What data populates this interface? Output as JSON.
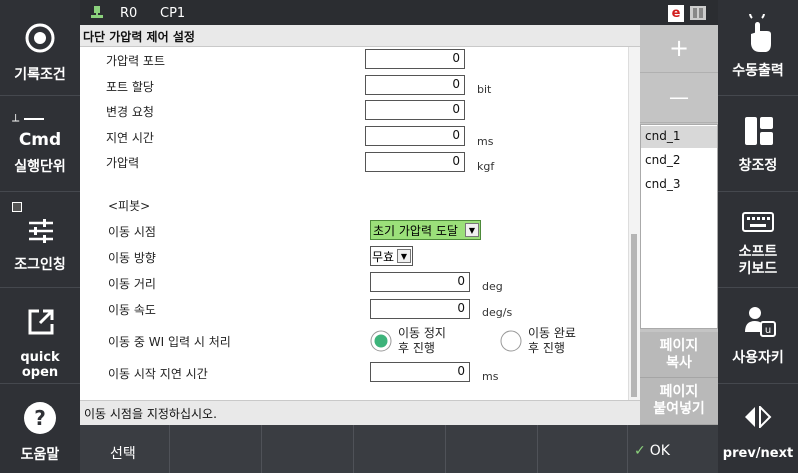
{
  "topbar": {
    "robot": "R0",
    "cp": "CP1",
    "e_badge": "e"
  },
  "left_sidebar": {
    "rec_condition": "기록조건",
    "cmd_title": "Cmd",
    "cmd_label": "실행단위",
    "jog_label": "조그인칭",
    "quick_open": "quick open",
    "help": "도움말"
  },
  "right_sidebar": {
    "manual_output": "수동출력",
    "window_control": "창조정",
    "soft_keyboard": "소프트\n키보드",
    "user_key": "사용자키",
    "prev_next": "prev/next"
  },
  "dialog": {
    "title": "다단 가압력 제어 설정",
    "rows": [
      {
        "label": "가압력 포트",
        "value": "0",
        "unit": ""
      },
      {
        "label": "포트 할당",
        "value": "0",
        "unit": "bit"
      },
      {
        "label": "변경 요청",
        "value": "0",
        "unit": ""
      },
      {
        "label": "지연 시간",
        "value": "0",
        "unit": "ms"
      },
      {
        "label": "가압력",
        "value": "0",
        "unit": "kgf"
      }
    ],
    "pivot_header": "<피봇>",
    "move_time_label": "이동 시점",
    "move_time_value": "초기 가압력 도달",
    "move_dir_label": "이동 방향",
    "move_dir_value": "무효",
    "move_dist_label": "이동 거리",
    "move_dist_value": "0",
    "move_dist_unit": "deg",
    "move_speed_label": "이동 속도",
    "move_speed_value": "0",
    "move_speed_unit": "deg/s",
    "wi_label": "이동 중 WI 입력 시 처리",
    "wi_opt1": "이동 정지\n후 진행",
    "wi_opt2": "이동 완료\n후 진행",
    "delay_label": "이동 시작 지연 시간",
    "delay_value": "0",
    "delay_unit": "ms"
  },
  "status_message": "이동 시점을 지정하십시오.",
  "right_panel": {
    "plus": "+",
    "minus": "—",
    "conditions": [
      "cnd_1",
      "cnd_2",
      "cnd_3"
    ],
    "page_copy": "페이지\n복사",
    "page_paste": "페이지\n붙여넣기"
  },
  "bottom": {
    "select": "선택",
    "ok": "OK"
  },
  "colors": {
    "sidebar": "#2f3136",
    "accent_green": "#3db37a",
    "dropdown_green": "#9be07a"
  }
}
